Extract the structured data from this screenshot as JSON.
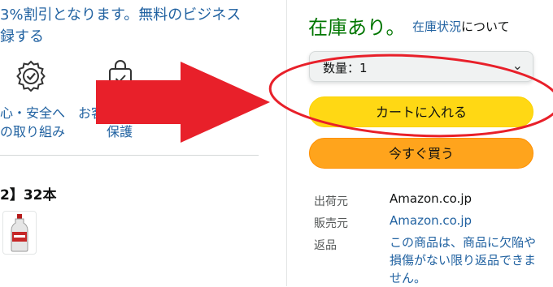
{
  "promo": {
    "line1": "3%割引となります。無料のビジネス",
    "line2": "録する"
  },
  "features": [
    {
      "icon": "shield-check-icon",
      "line1": "心・安全へ",
      "line2": "の取り組み"
    },
    {
      "icon": "shopping-bag-icon",
      "line1": "お客様情報の",
      "line2": "保護"
    }
  ],
  "product": {
    "title": "2】32本",
    "thumbnail_icon": "bottle-icon"
  },
  "buybox": {
    "stock": "在庫あり。",
    "stock_link": "在庫状況",
    "stock_link_suffix": "について",
    "quantity": "数量：1",
    "add_to_cart": "カートに入れる",
    "buy_now": "今すぐ買う",
    "ships_from_label": "出荷元",
    "ships_from": "Amazon.co.jp",
    "sold_by_label": "販売元",
    "sold_by": "Amazon.co.jp",
    "returns_label": "返品",
    "returns_text": "この商品は、商品に欠陥や損傷がない限り返品できません。"
  },
  "colors": {
    "stock_green": "#007600",
    "link_blue": "#2162a1",
    "cart_yellow": "#ffd814",
    "buy_orange": "#ffa41c",
    "annotation_red": "#e8202a"
  },
  "annotations": {
    "arrow_icon": "red-arrow-icon",
    "ellipse_icon": "red-ellipse-icon"
  }
}
